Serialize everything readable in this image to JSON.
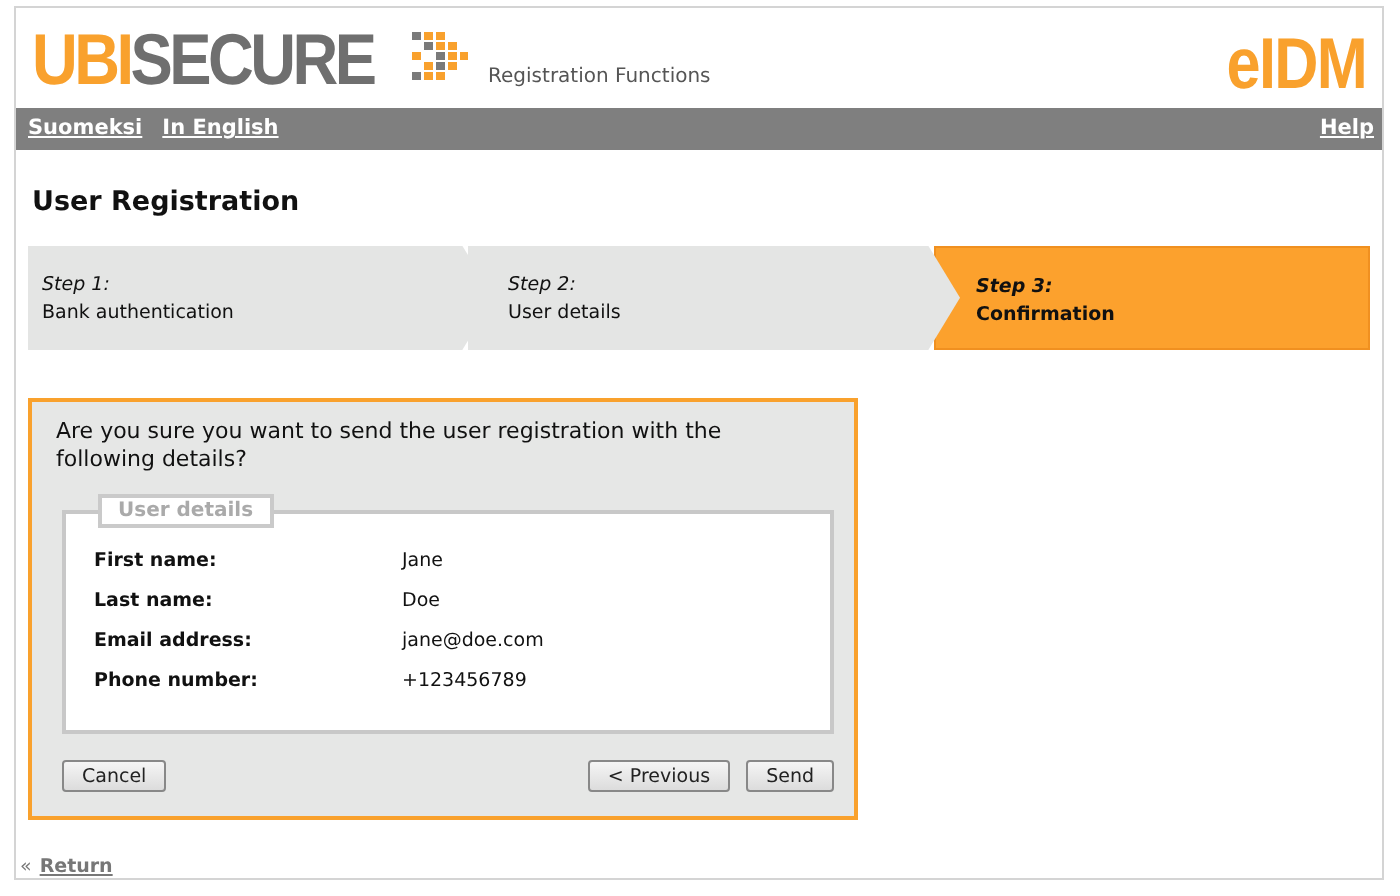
{
  "header": {
    "logo": {
      "part_1": "UBI",
      "part_2": "SECURE"
    },
    "subtitle": "Registration Functions",
    "product": "eIDM"
  },
  "nav": {
    "languages": [
      {
        "label": "Suomeksi"
      },
      {
        "label": "In English"
      }
    ],
    "help": "Help"
  },
  "title": "User Registration",
  "steps": [
    {
      "number": "Step 1:",
      "label": "Bank authentication",
      "selected": false
    },
    {
      "number": "Step 2:",
      "label": "User details",
      "selected": false
    },
    {
      "number": "Step 3:",
      "label": "Confirmation",
      "selected": true
    }
  ],
  "form": {
    "question": "Are you sure you want to send the user registration with the following details?",
    "legend": "User details",
    "fields": [
      {
        "label": "First name:",
        "value": "Jane"
      },
      {
        "label": "Last name:",
        "value": "Doe"
      },
      {
        "label": "Email address:",
        "value": "jane@doe.com"
      },
      {
        "label": "Phone number:",
        "value": "+123456789"
      }
    ],
    "cancel": "Cancel",
    "previous": "< Previous",
    "send": "Send"
  },
  "footer": {
    "marker": "«",
    "link": "Return"
  }
}
